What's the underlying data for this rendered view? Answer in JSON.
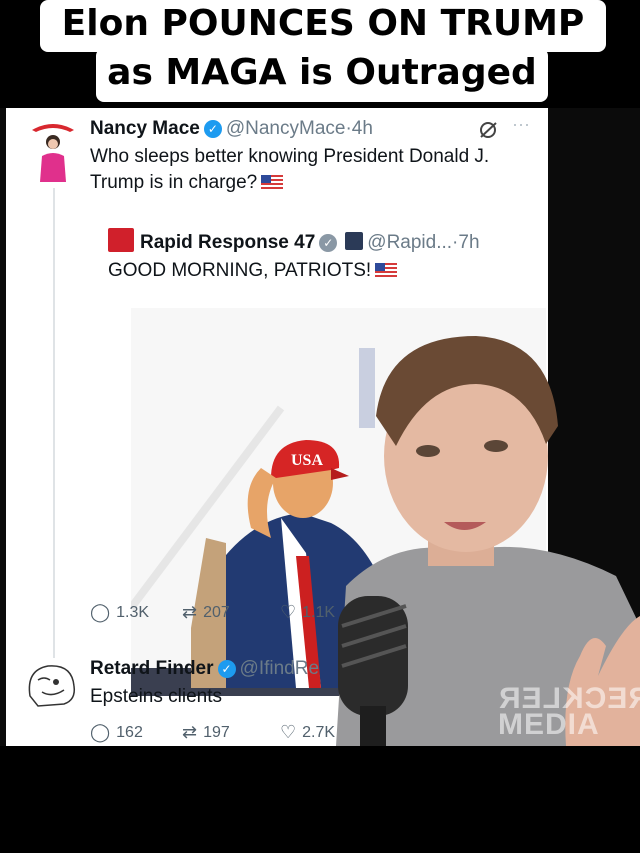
{
  "header": {
    "line1": "Elon POUNCES ON TRUMP",
    "line2": "as MAGA is Outraged"
  },
  "tweet1": {
    "author": "Nancy Mace",
    "handle_time": "@NancyMace·4h",
    "text_line1": "Who sleeps better knowing President Donald J.",
    "text_line2": "Trump is in charge?",
    "icons": [
      "verified-badge",
      "grok-icon",
      "more-icon",
      "us-flag"
    ],
    "quote": {
      "author": "Rapid Response 47",
      "handle_time": "@Rapid...·7h",
      "text": "GOOD MORNING, PATRIOTS!",
      "hat_text": "USA"
    },
    "actions": {
      "replies": "1.3K",
      "reposts": "207",
      "likes": "1.1K"
    }
  },
  "tweet2": {
    "author": "Retard Finder",
    "handle": "@IfindRe",
    "text": "Epsteins clients",
    "actions": {
      "replies": "162",
      "reposts": "197",
      "likes": "2.7K"
    }
  },
  "watermark": {
    "line1": "RECKLER",
    "line2": "MEDIA"
  },
  "colors": {
    "verified": "#1d9bf0",
    "accent_red": "#d0202b",
    "handle_gray": "#6b7b88"
  }
}
